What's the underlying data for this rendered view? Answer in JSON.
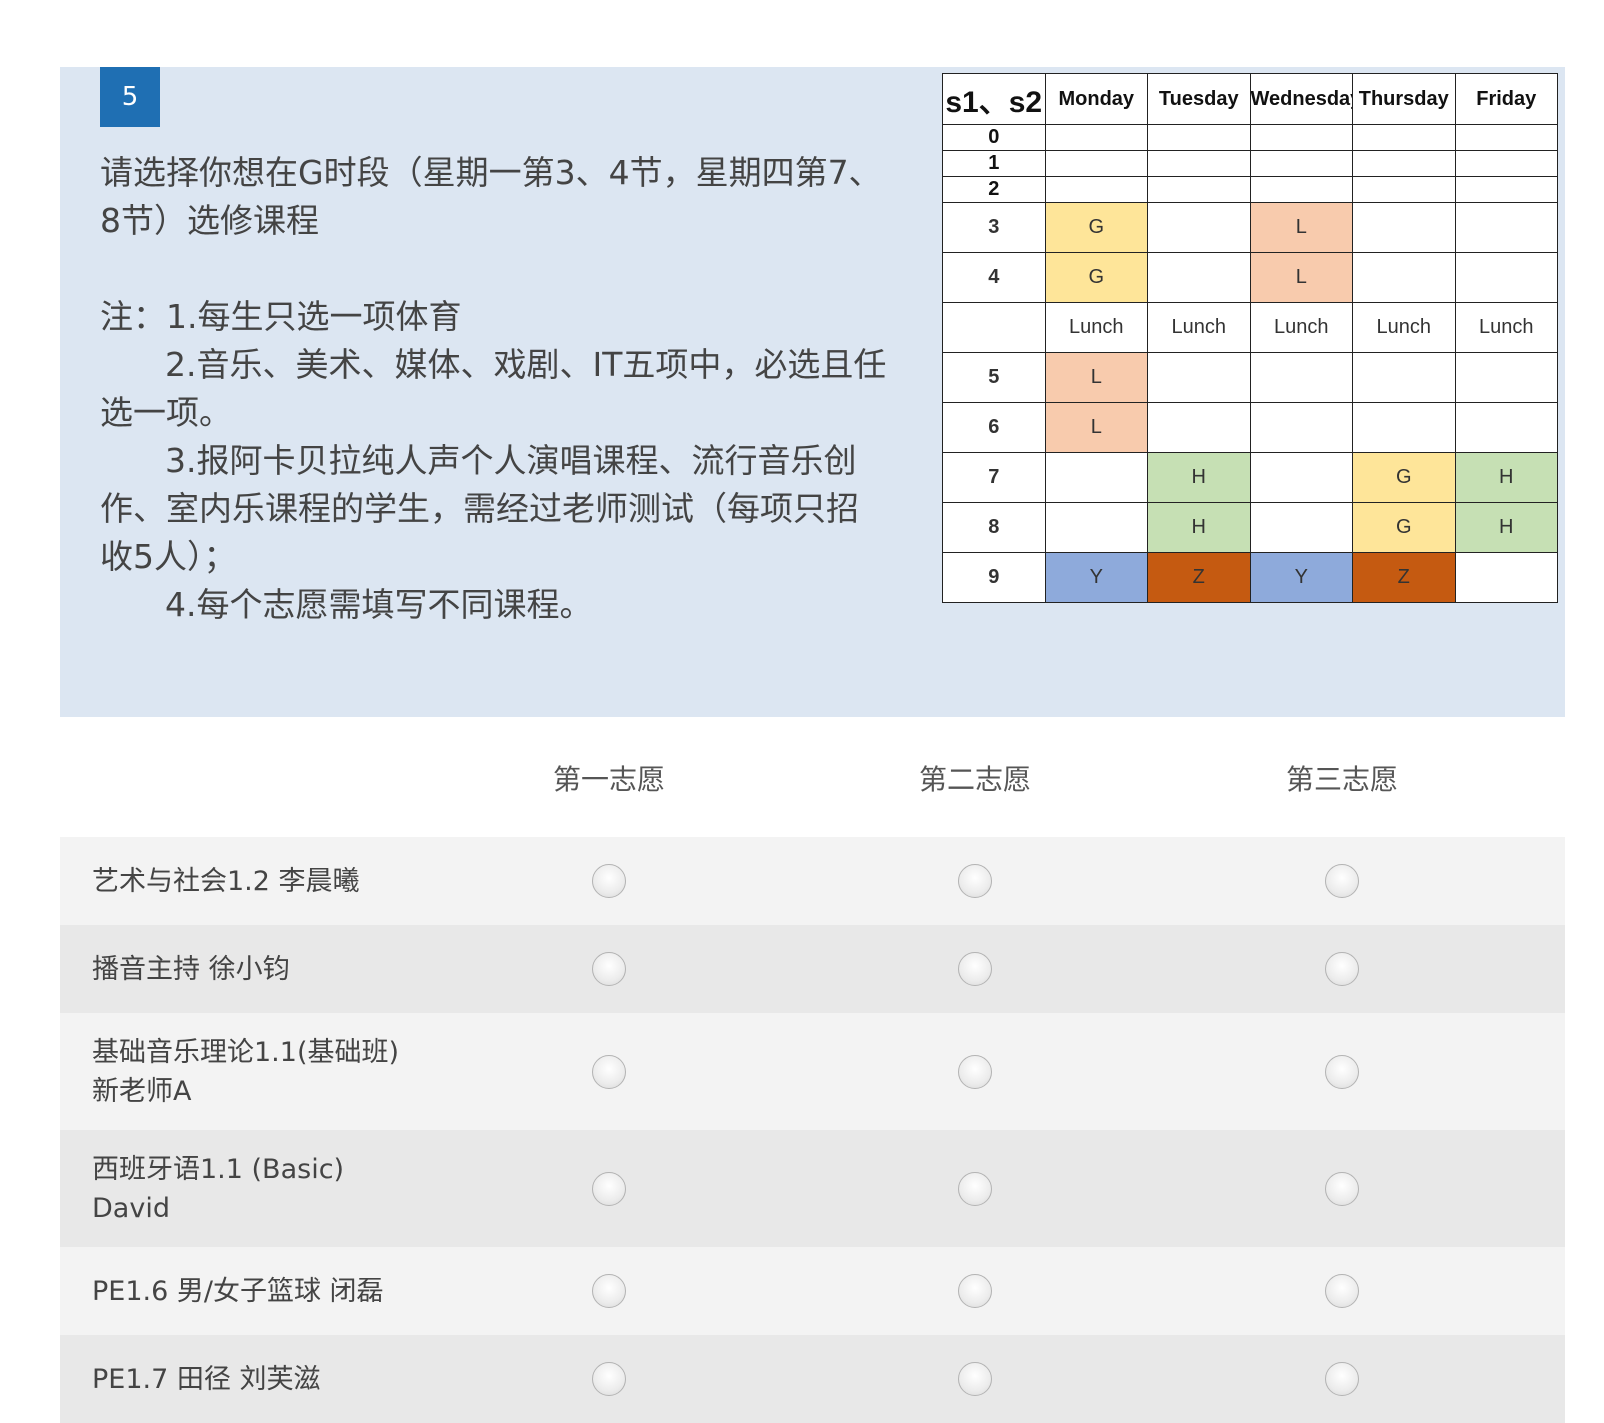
{
  "question": {
    "number": "5",
    "title_line1": "请选择你想在G时段（星期一第3、4节，星期四第7、",
    "title_line2": "8节）选修课程",
    "note_line1": "注：1.每生只选一项体育",
    "note_line2a": "2.音乐、美术、媒体、戏剧、IT五项中，必选且任",
    "note_line2b": "选一项。",
    "note_line3a": "3.报阿卡贝拉纯人声个人演唱课程、流行音乐创",
    "note_line3b": "作、室内乐课程的学生，需经过老师测试（每项只招",
    "note_line3c": "收5人）；",
    "note_line4": "4.每个志愿需填写不同课程。"
  },
  "schedule": {
    "corner": "s1、s2",
    "days": [
      "Monday",
      "Tuesday",
      "Wednesday",
      "Thursday",
      "Friday"
    ],
    "rows": [
      {
        "period": "0",
        "cells": [
          "",
          "",
          "",
          "",
          ""
        ]
      },
      {
        "period": "1",
        "cells": [
          "",
          "",
          "",
          "",
          ""
        ]
      },
      {
        "period": "2",
        "cells": [
          "",
          "",
          "",
          "",
          ""
        ]
      },
      {
        "period": "3",
        "cells": [
          "G",
          "",
          "L",
          "",
          ""
        ]
      },
      {
        "period": "4",
        "cells": [
          "G",
          "",
          "L",
          "",
          ""
        ]
      },
      {
        "period": "",
        "cells": [
          "Lunch",
          "Lunch",
          "Lunch",
          "Lunch",
          "Lunch"
        ]
      },
      {
        "period": "5",
        "cells": [
          "L",
          "",
          "",
          "",
          ""
        ]
      },
      {
        "period": "6",
        "cells": [
          "L",
          "",
          "",
          "",
          ""
        ]
      },
      {
        "period": "7",
        "cells": [
          "",
          "H",
          "",
          "G",
          "H"
        ]
      },
      {
        "period": "8",
        "cells": [
          "",
          "H",
          "",
          "G",
          "H"
        ]
      },
      {
        "period": "9",
        "cells": [
          "Y",
          "Z",
          "Y",
          "Z",
          ""
        ]
      }
    ],
    "colors": {
      "G": "#fee599",
      "L": "#f8cbad",
      "H": "#c6e0b4",
      "Y": "#8eaadb",
      "Z": "#c55a11"
    }
  },
  "choices": {
    "columns": [
      "第一志愿",
      "第二志愿",
      "第三志愿"
    ],
    "options": [
      {
        "line1": "艺术与社会1.2 李晨曦",
        "line2": ""
      },
      {
        "line1": "播音主持 徐小钧",
        "line2": ""
      },
      {
        "line1": "基础音乐理论1.1(基础班)",
        "line2": "新老师A"
      },
      {
        "line1": "西班牙语1.1 (Basic)",
        "line2": "David"
      },
      {
        "line1": "PE1.6 男/女子篮球 闭磊",
        "line2": ""
      },
      {
        "line1": "PE1.7 田径 刘芙滋",
        "line2": ""
      }
    ]
  }
}
